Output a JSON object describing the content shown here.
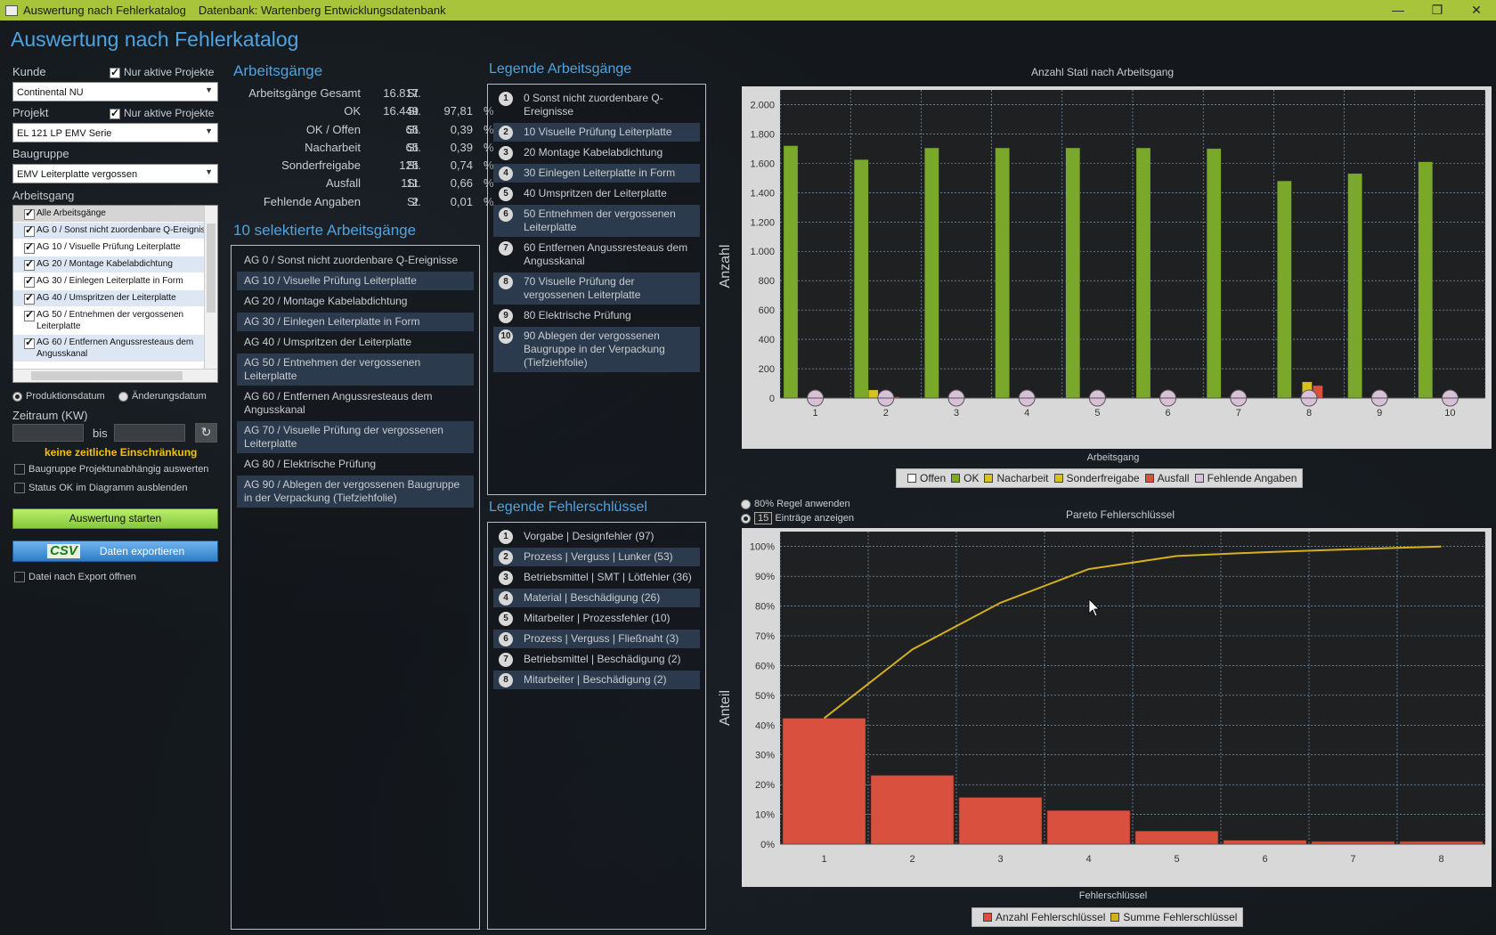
{
  "window": {
    "title": "Auswertung nach Fehlerkatalog",
    "db_label": "Datenbank: Wartenberg Entwicklungsdatenbank",
    "btn_min": "—",
    "btn_max": "❐",
    "btn_close": "✕"
  },
  "app_title": "Auswertung nach Fehlerkatalog",
  "filters": {
    "kunde_label": "Kunde",
    "nur_aktive_label": "Nur aktive Projekte",
    "kunde_value": "Continental NU",
    "projekt_label": "Projekt",
    "projekt_value": "EL 121 LP EMV Serie",
    "baugruppe_label": "Baugruppe",
    "baugruppe_value": "EMV Leiterplatte vergossen",
    "arbeitsgang_label": "Arbeitsgang",
    "ag_items": [
      "Alle Arbeitsgänge",
      "AG 0 / Sonst nicht zuordenbare Q-Ereignisse",
      "AG 10 / Visuelle Prüfung Leiterplatte",
      "AG 20 / Montage Kabelabdichtung",
      "AG 30 / Einlegen Leiterplatte in Form",
      "AG 40 / Umspritzen der Leiterplatte",
      "AG 50 / Entnehmen der vergossenen Leiterplatte",
      "AG 60 / Entfernen Angussresteaus dem Angusskanal"
    ],
    "radio_prod": "Produktionsdatum",
    "radio_aend": "Änderungsdatum",
    "zeitraum_label": "Zeitraum (KW)",
    "bis": "bis",
    "no_limit": "keine zeitliche Einschränkung",
    "cb_projektunabh": "Baugruppe Projektunabhängig auswerten",
    "cb_status_ok": "Status OK im Diagramm ausblenden",
    "btn_start": "Auswertung starten",
    "btn_export_icon": "CSV",
    "btn_export": "Daten exportieren",
    "cb_open_after": "Datei nach Export öffnen"
  },
  "arbeitsgaenge": {
    "heading": "Arbeitsgänge",
    "rows": [
      {
        "k": "Arbeitsgänge Gesamt",
        "v": "16.817",
        "u": "St.",
        "p": "",
        "pc": ""
      },
      {
        "k": "OK",
        "v": "16.449",
        "u": "St.",
        "p": "97,81",
        "pc": "%"
      },
      {
        "k": "OK / Offen",
        "v": "65",
        "u": "St.",
        "p": "0,39",
        "pc": "%"
      },
      {
        "k": "Nacharbeit",
        "v": "65",
        "u": "St.",
        "p": "0,39",
        "pc": "%"
      },
      {
        "k": "Sonderfreigabe",
        "v": "125",
        "u": "St.",
        "p": "0,74",
        "pc": "%"
      },
      {
        "k": "Ausfall",
        "v": "111",
        "u": "St.",
        "p": "0,66",
        "pc": "%"
      },
      {
        "k": "Fehlende Angaben",
        "v": "2",
        "u": "St.",
        "p": "0,01",
        "pc": "%"
      }
    ]
  },
  "selected": {
    "heading": "10 selektierte Arbeitsgänge",
    "items": [
      "AG 0 / Sonst nicht zuordenbare Q-Ereignisse",
      "AG 10 / Visuelle Prüfung Leiterplatte",
      "AG 20 / Montage Kabelabdichtung",
      "AG 30 / Einlegen Leiterplatte in Form",
      "AG 40 / Umspritzen der Leiterplatte",
      "AG 50 / Entnehmen der vergossenen Leiterplatte",
      "AG 60 / Entfernen Angussresteaus dem Angusskanal",
      "AG 70 / Visuelle Prüfung der vergossenen Leiterplatte",
      "AG 80 / Elektrische Prüfung",
      "AG 90 / Ablegen der vergossenen Baugruppe in der Verpackung (Tiefziehfolie)"
    ]
  },
  "legende_ag": {
    "heading": "Legende Arbeitsgänge",
    "items": [
      "0 Sonst nicht zuordenbare Q-Ereignisse",
      "10 Visuelle Prüfung Leiterplatte",
      "20 Montage Kabelabdichtung",
      "30 Einlegen Leiterplatte in Form",
      "40 Umspritzen der Leiterplatte",
      "50 Entnehmen der vergossenen Leiterplatte",
      "60 Entfernen Angussresteaus dem Angusskanal",
      "70 Visuelle Prüfung der vergossenen Leiterplatte",
      "80 Elektrische Prüfung",
      "90 Ablegen der vergossenen Baugruppe in der Verpackung (Tiefziehfolie)"
    ]
  },
  "legende_fs": {
    "heading": "Legende Fehlerschlüssel",
    "items": [
      "Vorgabe | Designfehler (97)",
      "Prozess | Verguss | Lunker (53)",
      "Betriebsmittel | SMT | Lötfehler (36)",
      "Material | Beschädigung (26)",
      "Mitarbeiter | Prozessfehler (10)",
      "Prozess | Verguss | Fließnaht (3)",
      "Betriebsmittel | Beschädigung (2)",
      "Mitarbeiter | Beschädigung (2)"
    ]
  },
  "pareto_opts": {
    "regel": "80% Regel anwenden",
    "count": "15",
    "eintraege": "Einträge anzeigen"
  },
  "colors": {
    "ok": "#79a82a",
    "nacharbeit": "#d9c21c",
    "sonderfreigabe": "#d9c21c",
    "ausfall": "#d9503e",
    "offen": "#ffffff",
    "fehlend": "#d8c0d8",
    "pareto_bar": "#d9503e",
    "pareto_line": "#d4b01c",
    "accent": "#4fa3e0"
  },
  "chart_data": [
    {
      "type": "bar",
      "title": "Anzahl Stati nach Arbeitsgang",
      "xlabel": "Arbeitsgang",
      "ylabel": "Anzahl",
      "categories": [
        "1",
        "2",
        "3",
        "4",
        "5",
        "6",
        "7",
        "8",
        "9",
        "10"
      ],
      "ylim": [
        0,
        2100
      ],
      "yticks": [
        "0",
        "200",
        "400",
        "600",
        "800",
        "1.000",
        "1.200",
        "1.400",
        "1.600",
        "1.800",
        "2.000"
      ],
      "series": [
        {
          "name": "Offen",
          "values": [
            0,
            0,
            0,
            0,
            0,
            0,
            0,
            0,
            0,
            0
          ]
        },
        {
          "name": "OK",
          "values": [
            1720,
            1625,
            1705,
            1705,
            1705,
            1705,
            1700,
            1480,
            1530,
            1610
          ]
        },
        {
          "name": "Nacharbeit",
          "values": [
            0,
            55,
            0,
            0,
            0,
            0,
            0,
            0,
            0,
            0
          ]
        },
        {
          "name": "Sonderfreigabe",
          "values": [
            0,
            15,
            0,
            0,
            0,
            0,
            0,
            110,
            0,
            0
          ]
        },
        {
          "name": "Ausfall",
          "values": [
            0,
            8,
            0,
            0,
            5,
            0,
            0,
            85,
            0,
            0
          ]
        },
        {
          "name": "Fehlende Angaben",
          "values": [
            0,
            0,
            0,
            0,
            0,
            0,
            0,
            0,
            0,
            0
          ]
        }
      ],
      "grid": true,
      "legend": "bottom"
    },
    {
      "type": "bar",
      "title": "Pareto Fehlerschlüssel",
      "xlabel": "Fehlerschlüssel",
      "ylabel": "Anteil",
      "categories": [
        "1",
        "2",
        "3",
        "4",
        "5",
        "6",
        "7",
        "8"
      ],
      "ylim": [
        0,
        105
      ],
      "yticks": [
        "0%",
        "10%",
        "20%",
        "30%",
        "40%",
        "50%",
        "60%",
        "70%",
        "80%",
        "90%",
        "100%"
      ],
      "series": [
        {
          "name": "Anzahl Fehlerschlüssel",
          "values": [
            42.3,
            23.1,
            15.7,
            11.3,
            4.4,
            1.3,
            0.9,
            0.9
          ]
        },
        {
          "name": "Summe Fehlerschlüssel",
          "values": [
            42.3,
            65.4,
            81.1,
            92.4,
            96.8,
            98.1,
            99.1,
            100
          ]
        }
      ],
      "grid": true,
      "legend": "bottom"
    }
  ]
}
